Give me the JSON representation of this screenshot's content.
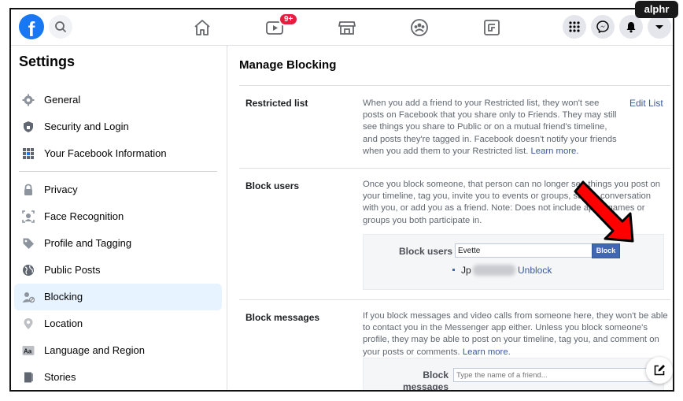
{
  "watermark": "alphr",
  "topbar": {
    "logo_letter": "f",
    "watch_badge": "9+"
  },
  "sidebar": {
    "title": "Settings",
    "items": [
      {
        "label": "General",
        "icon": "gear-icon"
      },
      {
        "label": "Security and Login",
        "icon": "shield-icon"
      },
      {
        "label": "Your Facebook Information",
        "icon": "grid-icon"
      },
      {
        "label": "Privacy",
        "icon": "lock-icon"
      },
      {
        "label": "Face Recognition",
        "icon": "face-icon"
      },
      {
        "label": "Profile and Tagging",
        "icon": "tag-icon"
      },
      {
        "label": "Public Posts",
        "icon": "globe-icon"
      },
      {
        "label": "Blocking",
        "icon": "block-user-icon",
        "active": true
      },
      {
        "label": "Location",
        "icon": "location-pin-icon"
      },
      {
        "label": "Language and Region",
        "icon": "language-icon"
      },
      {
        "label": "Stories",
        "icon": "book-icon"
      }
    ]
  },
  "main": {
    "title": "Manage Blocking",
    "restricted": {
      "label": "Restricted list",
      "text": "When you add a friend to your Restricted list, they won't see posts on Facebook that you share only to Friends. They may still see things you share to Public or on a mutual friend's timeline, and posts they're tagged in. Facebook doesn't notify your friends when you add them to your Restricted list.",
      "learn_more": "Learn more.",
      "edit_link": "Edit List"
    },
    "block_users": {
      "label": "Block users",
      "text": "Once you block someone, that person can no longer see things you post on your timeline, tag you, invite you to events or groups, start a conversation with you, or add you as a friend. Note: Does not include apps, games or groups you both participate in.",
      "field_label": "Block users",
      "input_value": "Evette",
      "button_label": "Block",
      "blocked_name": "Jp",
      "unblock_label": "Unblock"
    },
    "block_messages": {
      "label": "Block messages",
      "text": "If you block messages and video calls from someone here, they won't be able to contact you in the Messenger app either. Unless you block someone's profile, they may be able to post on your timeline, tag you, and comment on your posts or comments.",
      "learn_more": "Learn more.",
      "field_label": "Block messages from",
      "input_placeholder": "Type the name of a friend..."
    }
  },
  "colors": {
    "brand": "#1877f2",
    "button": "#4267b2",
    "link": "#385898",
    "badge": "#e41e3f",
    "arrow": "#ff0000"
  }
}
